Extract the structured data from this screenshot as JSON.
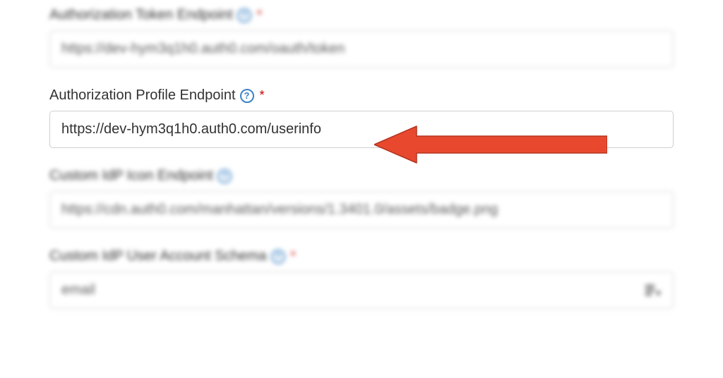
{
  "fields": {
    "token_endpoint": {
      "label": "Authorization Token Endpoint",
      "required": true,
      "value": "https://dev-hym3q1h0.auth0.com/oauth/token"
    },
    "profile_endpoint": {
      "label": "Authorization Profile Endpoint",
      "required": true,
      "value": "https://dev-hym3q1h0.auth0.com/userinfo"
    },
    "icon_endpoint": {
      "label": "Custom IdP Icon Endpoint",
      "required": false,
      "value": "https://cdn.auth0.com/manhattan/versions/1.3401.0/assets/badge.png"
    },
    "schema": {
      "label": "Custom IdP User Account Schema",
      "required": true,
      "value": "email"
    }
  },
  "glyphs": {
    "help": "?",
    "asterisk": "*"
  },
  "colors": {
    "arrow": "#e8492e",
    "help_icon": "#3b82c4",
    "required": "#cc0000"
  }
}
